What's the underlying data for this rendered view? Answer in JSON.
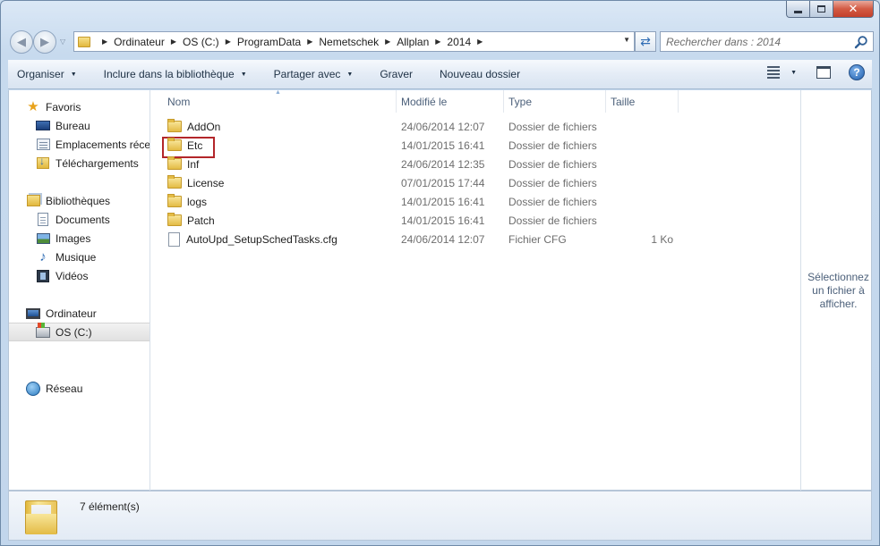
{
  "window": {
    "minimize_label": "minimize",
    "maximize_label": "maximize",
    "close_label": "close"
  },
  "address_bar": {
    "crumbs": [
      "Ordinateur",
      "OS (C:)",
      "ProgramData",
      "Nemetschek",
      "Allplan",
      "2014"
    ]
  },
  "search": {
    "placeholder": "Rechercher dans : 2014"
  },
  "toolbar": {
    "organize": "Organiser",
    "include_library": "Inclure dans la bibliothèque",
    "share_with": "Partager avec",
    "burn": "Graver",
    "new_folder": "Nouveau dossier"
  },
  "sidebar": {
    "favorites": "Favoris",
    "desktop": "Bureau",
    "recent_places": "Emplacements récents",
    "downloads": "Téléchargements",
    "libraries": "Bibliothèques",
    "documents": "Documents",
    "pictures": "Images",
    "music": "Musique",
    "videos": "Vidéos",
    "computer": "Ordinateur",
    "drive_c": "OS (C:)",
    "network": "Réseau"
  },
  "columns": {
    "name": "Nom",
    "modified": "Modifié le",
    "type": "Type",
    "size": "Taille"
  },
  "files": [
    {
      "name": "AddOn",
      "modified": "24/06/2014 12:07",
      "type": "Dossier de fichiers",
      "size": "",
      "icon": "folder-icon"
    },
    {
      "name": "Etc",
      "modified": "14/01/2015 16:41",
      "type": "Dossier de fichiers",
      "size": "",
      "icon": "folder-icon",
      "highlighted": true
    },
    {
      "name": "Inf",
      "modified": "24/06/2014 12:35",
      "type": "Dossier de fichiers",
      "size": "",
      "icon": "folder-icon"
    },
    {
      "name": "License",
      "modified": "07/01/2015 17:44",
      "type": "Dossier de fichiers",
      "size": "",
      "icon": "folder-icon"
    },
    {
      "name": "logs",
      "modified": "14/01/2015 16:41",
      "type": "Dossier de fichiers",
      "size": "",
      "icon": "folder-icon"
    },
    {
      "name": "Patch",
      "modified": "14/01/2015 16:41",
      "type": "Dossier de fichiers",
      "size": "",
      "icon": "folder-icon"
    },
    {
      "name": "AutoUpd_SetupSchedTasks.cfg",
      "modified": "24/06/2014 12:07",
      "type": "Fichier CFG",
      "size": "1 Ko",
      "icon": "file-icon"
    }
  ],
  "preview": {
    "message": "Sélectionnez un fichier à afficher."
  },
  "details": {
    "item_count": "7 élément(s)"
  },
  "colors": {
    "highlight_border": "#b3262a",
    "accent": "#2f6db4"
  }
}
